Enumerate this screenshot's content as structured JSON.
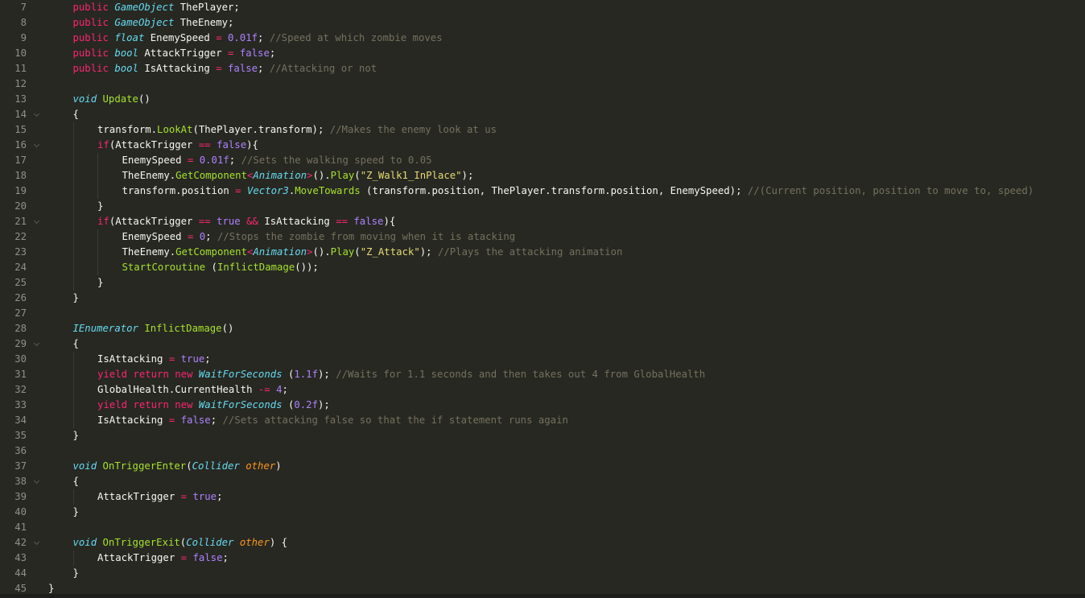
{
  "editor": {
    "theme_colors": {
      "background": "#272822",
      "text": "#f8f8f2",
      "keyword": "#f92672",
      "type": "#66d9ef",
      "function": "#a6e22e",
      "number": "#ae81ff",
      "string": "#e6db74",
      "comment": "#75715e",
      "parameter": "#fd971f",
      "line_number": "#90908a"
    },
    "lines": [
      {
        "num": "7",
        "indent": 1,
        "fold": false,
        "tokens": [
          [
            "kw",
            "public"
          ],
          [
            "t",
            " "
          ],
          [
            "ty it",
            "GameObject"
          ],
          [
            "t",
            " ThePlayer;"
          ]
        ]
      },
      {
        "num": "8",
        "indent": 1,
        "fold": false,
        "tokens": [
          [
            "kw",
            "public"
          ],
          [
            "t",
            " "
          ],
          [
            "ty it",
            "GameObject"
          ],
          [
            "t",
            " TheEnemy;"
          ]
        ]
      },
      {
        "num": "9",
        "indent": 1,
        "fold": false,
        "tokens": [
          [
            "kw",
            "public"
          ],
          [
            "t",
            " "
          ],
          [
            "ty it",
            "float"
          ],
          [
            "t",
            " EnemySpeed "
          ],
          [
            "kw",
            "="
          ],
          [
            "t",
            " "
          ],
          [
            "nu",
            "0.01f"
          ],
          [
            "t",
            "; "
          ],
          [
            "cm",
            "//Speed at which zombie moves"
          ]
        ]
      },
      {
        "num": "10",
        "indent": 1,
        "fold": false,
        "tokens": [
          [
            "kw",
            "public"
          ],
          [
            "t",
            " "
          ],
          [
            "ty it",
            "bool"
          ],
          [
            "t",
            " AttackTrigger "
          ],
          [
            "kw",
            "="
          ],
          [
            "t",
            " "
          ],
          [
            "nu",
            "false"
          ],
          [
            "t",
            ";"
          ]
        ]
      },
      {
        "num": "11",
        "indent": 1,
        "fold": false,
        "tokens": [
          [
            "kw",
            "public"
          ],
          [
            "t",
            " "
          ],
          [
            "ty it",
            "bool"
          ],
          [
            "t",
            " IsAttacking "
          ],
          [
            "kw",
            "="
          ],
          [
            "t",
            " "
          ],
          [
            "nu",
            "false"
          ],
          [
            "t",
            "; "
          ],
          [
            "cm",
            "//Attacking or not"
          ]
        ]
      },
      {
        "num": "12",
        "indent": 0,
        "fold": false,
        "tokens": []
      },
      {
        "num": "13",
        "indent": 1,
        "fold": false,
        "tokens": [
          [
            "ty it",
            "void"
          ],
          [
            "t",
            " "
          ],
          [
            "fn",
            "Update"
          ],
          [
            "t",
            "()"
          ]
        ]
      },
      {
        "num": "14",
        "indent": 1,
        "fold": true,
        "tokens": [
          [
            "t",
            "{"
          ]
        ]
      },
      {
        "num": "15",
        "indent": 2,
        "fold": false,
        "tokens": [
          [
            "t",
            "transform."
          ],
          [
            "fn",
            "LookAt"
          ],
          [
            "t",
            "(ThePlayer.transform); "
          ],
          [
            "cm",
            "//Makes the enemy look at us"
          ]
        ]
      },
      {
        "num": "16",
        "indent": 2,
        "fold": true,
        "tokens": [
          [
            "kw",
            "if"
          ],
          [
            "t",
            "(AttackTrigger "
          ],
          [
            "kw",
            "=="
          ],
          [
            "t",
            " "
          ],
          [
            "nu",
            "false"
          ],
          [
            "t",
            "){"
          ]
        ]
      },
      {
        "num": "17",
        "indent": 3,
        "fold": false,
        "tokens": [
          [
            "t",
            "EnemySpeed "
          ],
          [
            "kw",
            "="
          ],
          [
            "t",
            " "
          ],
          [
            "nu",
            "0.01f"
          ],
          [
            "t",
            "; "
          ],
          [
            "cm",
            "//Sets the walking speed to 0.05"
          ]
        ]
      },
      {
        "num": "18",
        "indent": 3,
        "fold": false,
        "tokens": [
          [
            "t",
            "TheEnemy."
          ],
          [
            "fn",
            "GetComponent"
          ],
          [
            "kw",
            "<"
          ],
          [
            "ty it",
            "Animation"
          ],
          [
            "kw",
            ">"
          ],
          [
            "t",
            "()."
          ],
          [
            "fn",
            "Play"
          ],
          [
            "t",
            "("
          ],
          [
            "st",
            "\"Z_Walk1_InPlace\""
          ],
          [
            "t",
            ");"
          ]
        ]
      },
      {
        "num": "19",
        "indent": 3,
        "fold": false,
        "tokens": [
          [
            "t",
            "transform.position "
          ],
          [
            "kw",
            "="
          ],
          [
            "t",
            " "
          ],
          [
            "ty it",
            "Vector3"
          ],
          [
            "t",
            "."
          ],
          [
            "fn",
            "MoveTowards"
          ],
          [
            "t",
            " (transform.position, ThePlayer.transform.position, EnemySpeed); "
          ],
          [
            "cm",
            "//(Current position, position to move to, speed)"
          ]
        ]
      },
      {
        "num": "20",
        "indent": 2,
        "fold": false,
        "tokens": [
          [
            "t",
            "}"
          ]
        ]
      },
      {
        "num": "21",
        "indent": 2,
        "fold": true,
        "tokens": [
          [
            "kw",
            "if"
          ],
          [
            "t",
            "(AttackTrigger "
          ],
          [
            "kw",
            "=="
          ],
          [
            "t",
            " "
          ],
          [
            "nu",
            "true"
          ],
          [
            "t",
            " "
          ],
          [
            "kw",
            "&&"
          ],
          [
            "t",
            " IsAttacking "
          ],
          [
            "kw",
            "=="
          ],
          [
            "t",
            " "
          ],
          [
            "nu",
            "false"
          ],
          [
            "t",
            "){"
          ]
        ]
      },
      {
        "num": "22",
        "indent": 3,
        "fold": false,
        "tokens": [
          [
            "t",
            "EnemySpeed "
          ],
          [
            "kw",
            "="
          ],
          [
            "t",
            " "
          ],
          [
            "nu",
            "0"
          ],
          [
            "t",
            "; "
          ],
          [
            "cm",
            "//Stops the zombie from moving when it is atacking"
          ]
        ]
      },
      {
        "num": "23",
        "indent": 3,
        "fold": false,
        "tokens": [
          [
            "t",
            "TheEnemy."
          ],
          [
            "fn",
            "GetComponent"
          ],
          [
            "kw",
            "<"
          ],
          [
            "ty it",
            "Animation"
          ],
          [
            "kw",
            ">"
          ],
          [
            "t",
            "()."
          ],
          [
            "fn",
            "Play"
          ],
          [
            "t",
            "("
          ],
          [
            "st",
            "\"Z_Attack\""
          ],
          [
            "t",
            "); "
          ],
          [
            "cm",
            "//Plays the attacking animation"
          ]
        ]
      },
      {
        "num": "24",
        "indent": 3,
        "fold": false,
        "tokens": [
          [
            "fn",
            "StartCoroutine"
          ],
          [
            "t",
            " ("
          ],
          [
            "fn",
            "InflictDamage"
          ],
          [
            "t",
            "());"
          ]
        ]
      },
      {
        "num": "25",
        "indent": 2,
        "fold": false,
        "tokens": [
          [
            "t",
            "}"
          ]
        ]
      },
      {
        "num": "26",
        "indent": 1,
        "fold": false,
        "tokens": [
          [
            "t",
            "}"
          ]
        ]
      },
      {
        "num": "27",
        "indent": 0,
        "fold": false,
        "tokens": []
      },
      {
        "num": "28",
        "indent": 1,
        "fold": false,
        "tokens": [
          [
            "ty it",
            "IEnumerator"
          ],
          [
            "t",
            " "
          ],
          [
            "fn",
            "InflictDamage"
          ],
          [
            "t",
            "()"
          ]
        ]
      },
      {
        "num": "29",
        "indent": 1,
        "fold": true,
        "tokens": [
          [
            "t",
            "{"
          ]
        ]
      },
      {
        "num": "30",
        "indent": 2,
        "fold": false,
        "tokens": [
          [
            "t",
            "IsAttacking "
          ],
          [
            "kw",
            "="
          ],
          [
            "t",
            " "
          ],
          [
            "nu",
            "true"
          ],
          [
            "t",
            ";"
          ]
        ]
      },
      {
        "num": "31",
        "indent": 2,
        "fold": false,
        "tokens": [
          [
            "kw",
            "yield"
          ],
          [
            "t",
            " "
          ],
          [
            "kw",
            "return"
          ],
          [
            "t",
            " "
          ],
          [
            "kw",
            "new"
          ],
          [
            "t",
            " "
          ],
          [
            "ty it",
            "WaitForSeconds"
          ],
          [
            "t",
            " ("
          ],
          [
            "nu",
            "1.1f"
          ],
          [
            "t",
            "); "
          ],
          [
            "cm",
            "//Waits for 1.1 seconds and then takes out 4 from GlobalHealth"
          ]
        ]
      },
      {
        "num": "32",
        "indent": 2,
        "fold": false,
        "tokens": [
          [
            "t",
            "GlobalHealth.CurrentHealth "
          ],
          [
            "kw",
            "-="
          ],
          [
            "t",
            " "
          ],
          [
            "nu",
            "4"
          ],
          [
            "t",
            ";"
          ]
        ]
      },
      {
        "num": "33",
        "indent": 2,
        "fold": false,
        "tokens": [
          [
            "kw",
            "yield"
          ],
          [
            "t",
            " "
          ],
          [
            "kw",
            "return"
          ],
          [
            "t",
            " "
          ],
          [
            "kw",
            "new"
          ],
          [
            "t",
            " "
          ],
          [
            "ty it",
            "WaitForSeconds"
          ],
          [
            "t",
            " ("
          ],
          [
            "nu",
            "0.2f"
          ],
          [
            "t",
            ");"
          ]
        ]
      },
      {
        "num": "34",
        "indent": 2,
        "fold": false,
        "tokens": [
          [
            "t",
            "IsAttacking "
          ],
          [
            "kw",
            "="
          ],
          [
            "t",
            " "
          ],
          [
            "nu",
            "false"
          ],
          [
            "t",
            "; "
          ],
          [
            "cm",
            "//Sets attacking false so that the if statement runs again"
          ]
        ]
      },
      {
        "num": "35",
        "indent": 1,
        "fold": false,
        "tokens": [
          [
            "t",
            "}"
          ]
        ]
      },
      {
        "num": "36",
        "indent": 0,
        "fold": false,
        "tokens": []
      },
      {
        "num": "37",
        "indent": 1,
        "fold": false,
        "tokens": [
          [
            "ty it",
            "void"
          ],
          [
            "t",
            " "
          ],
          [
            "fn",
            "OnTriggerEnter"
          ],
          [
            "t",
            "("
          ],
          [
            "ty it",
            "Collider"
          ],
          [
            "t",
            " "
          ],
          [
            "pa",
            "other"
          ],
          [
            "t",
            ")"
          ]
        ]
      },
      {
        "num": "38",
        "indent": 1,
        "fold": true,
        "tokens": [
          [
            "t",
            "{"
          ]
        ]
      },
      {
        "num": "39",
        "indent": 2,
        "fold": false,
        "tokens": [
          [
            "t",
            "AttackTrigger "
          ],
          [
            "kw",
            "="
          ],
          [
            "t",
            " "
          ],
          [
            "nu",
            "true"
          ],
          [
            "t",
            ";"
          ]
        ]
      },
      {
        "num": "40",
        "indent": 1,
        "fold": false,
        "tokens": [
          [
            "t",
            "}"
          ]
        ]
      },
      {
        "num": "41",
        "indent": 0,
        "fold": false,
        "tokens": []
      },
      {
        "num": "42",
        "indent": 1,
        "fold": true,
        "tokens": [
          [
            "ty it",
            "void"
          ],
          [
            "t",
            " "
          ],
          [
            "fn",
            "OnTriggerExit"
          ],
          [
            "t",
            "("
          ],
          [
            "ty it",
            "Collider"
          ],
          [
            "t",
            " "
          ],
          [
            "pa",
            "other"
          ],
          [
            "t",
            ") {"
          ]
        ]
      },
      {
        "num": "43",
        "indent": 2,
        "fold": false,
        "tokens": [
          [
            "t",
            "AttackTrigger "
          ],
          [
            "kw",
            "="
          ],
          [
            "t",
            " "
          ],
          [
            "nu",
            "false"
          ],
          [
            "t",
            ";"
          ]
        ]
      },
      {
        "num": "44",
        "indent": 1,
        "fold": false,
        "tokens": [
          [
            "t",
            "}"
          ]
        ]
      },
      {
        "num": "45",
        "indent": 0,
        "fold": false,
        "tokens": [
          [
            "t",
            "}"
          ]
        ]
      }
    ]
  }
}
